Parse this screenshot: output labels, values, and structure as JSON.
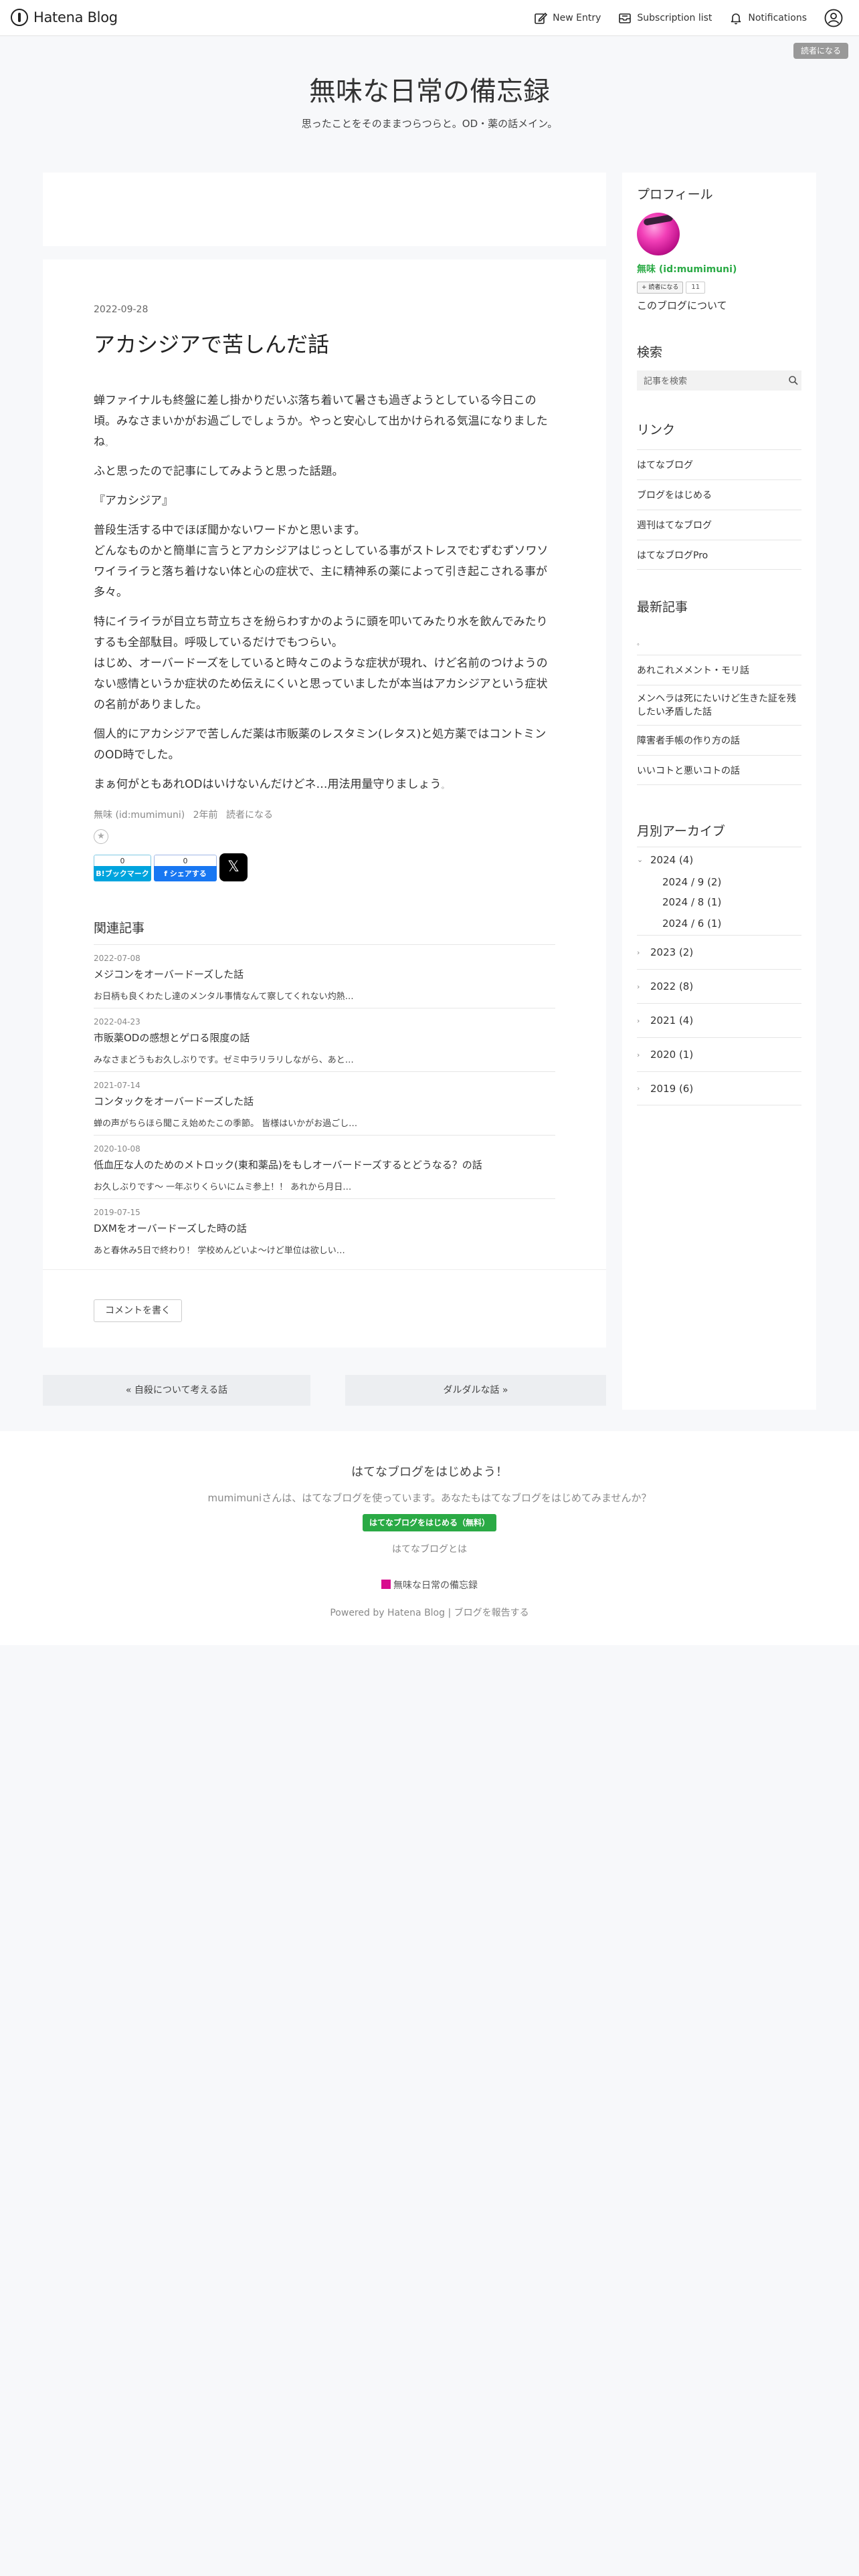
{
  "header": {
    "logo_text": "Hatena Blog",
    "new_entry": "New Entry",
    "subscription_list": "Subscription list",
    "notifications": "Notifications",
    "subscribe_pill": "読者になる"
  },
  "blog": {
    "title": "無味な日常の備忘録",
    "description": "思ったことをそのままつらつらと。OD・薬の話メイン。"
  },
  "entry": {
    "date": "2022-09-28",
    "title": "アカシジアで苦しんだ話",
    "paragraphs": [
      "蝉ファイナルも終盤に差し掛かりだいぶ落ち着いて暑さも過ぎようとしている今日この頃。みなさまいかがお過ごしでしょうか。やっと安心して出かけられる気温になりましたね𓈒",
      "ふと思ったので記事にしてみようと思った話題。",
      "『アカシジア』",
      "普段生活する中でほぼ聞かないワードかと思います。\nどんなものかと簡単に言うとアカシジアはじっとしている事がストレスでむずむずソワソワイライラと落ち着けない体と心の症状で、主に精神系の薬によって引き起こされる事が多々。",
      "特にイライラが目立ち苛立ちさを紛らわすかのように頭を叩いてみたり水を飲んでみたりするも全部駄目。呼吸しているだけでもつらい。\nはじめ、オーバードーズをしていると時々このような症状が現れ、けど名前のつけようのない感情というか症状のため伝えにくいと思っていましたが本当はアカシジアという症状の名前がありました。",
      "個人的にアカシジアで苦しんだ薬は市販薬のレスタミン(レタス)と処方薬ではコントミンのOD時でした。",
      "まぁ何がともあれODはいけないんだけどネ…用法用量守りましょう𓈒"
    ],
    "meta_author": "無味 (id:mumimuni)",
    "meta_time": "2年前",
    "meta_reader": "読者になる",
    "hatebu_count": "0",
    "hatebu_label": "B!ブックマーク",
    "fb_count": "0",
    "fb_label": "f シェアする",
    "x_label": "𝕏"
  },
  "related": {
    "title": "関連記事",
    "items": [
      {
        "date": "2022-07-08",
        "title": "メジコンをオーバードーズした話",
        "snippet": "お日柄も良くわたし達のメンタル事情なんて察してくれない灼熱…"
      },
      {
        "date": "2022-04-23",
        "title": "市販薬ODの感想とゲロる限度の話",
        "snippet": "みなさまどうもお久しぶりです。ゼミ中ラリラリしながら、あと…"
      },
      {
        "date": "2021-07-14",
        "title": "コンタックをオーバードーズした話",
        "snippet": "蝉の声がちらほら聞こえ始めたこの季節。 皆様はいかがお過ごし…"
      },
      {
        "date": "2020-10-08",
        "title": "低血圧な人のためのメトロック(東和薬品)をもしオーバードーズするとどうなる？の話",
        "snippet": "お久しぶりです〜 一年ぶりくらいにムミ参上！！ あれから月日…"
      },
      {
        "date": "2019-07-15",
        "title": "DXMをオーバードーズした時の話",
        "snippet": "あと春休み5日で終わり！ 学校めんどいよ〜けど単位は欲しい…"
      }
    ]
  },
  "comment_button": "コメントを書く",
  "pager": {
    "prev": "« 自殺について考える話",
    "next": "ダルダルな話 »"
  },
  "sidebar": {
    "profile_title": "プロフィール",
    "profile_name": "無味 (id:mumimuni)",
    "reader_button": "+ 読者になる",
    "reader_count": "11",
    "about_link": "このブログについて",
    "search_title": "検索",
    "search_placeholder": "記事を検索",
    "links_title": "リンク",
    "links": [
      "はてなブログ",
      "ブログをはじめる",
      "週刊はてなブログ",
      "はてなブログPro"
    ],
    "recent_title": "最新記事",
    "recent": [
      "𓈒",
      "あれこれメメント・モリ話",
      "メンヘラは死にたいけど生きた証を残したい矛盾した話",
      "障害者手帳の作り方の話",
      "いいコトと悪いコトの話"
    ],
    "archive_title": "月別アーカイブ",
    "archive": {
      "open_year": "2024 (4)",
      "months": [
        "2024 / 9 (2)",
        "2024 / 8 (1)",
        "2024 / 6 (1)"
      ],
      "years": [
        "2023 (2)",
        "2022 (8)",
        "2021 (4)",
        "2020 (1)",
        "2019 (6)"
      ]
    }
  },
  "footer": {
    "title": "はてなブログをはじめよう！",
    "text": "mumimuniさんは、はてなブログを使っています。あなたもはてなブログをはじめてみませんか？",
    "start_button": "はてなブログをはじめる（無料）",
    "about": "はてなブログとは",
    "blog_name": "無味な日常の備忘録",
    "powered": "Powered by Hatena Blog | ブログを報告する"
  },
  "colors": {
    "accent_green": "#2aaa45",
    "hatebu_blue": "#00a4de",
    "facebook_blue": "#1877f2",
    "avatar_pink": "#f23fb7"
  }
}
